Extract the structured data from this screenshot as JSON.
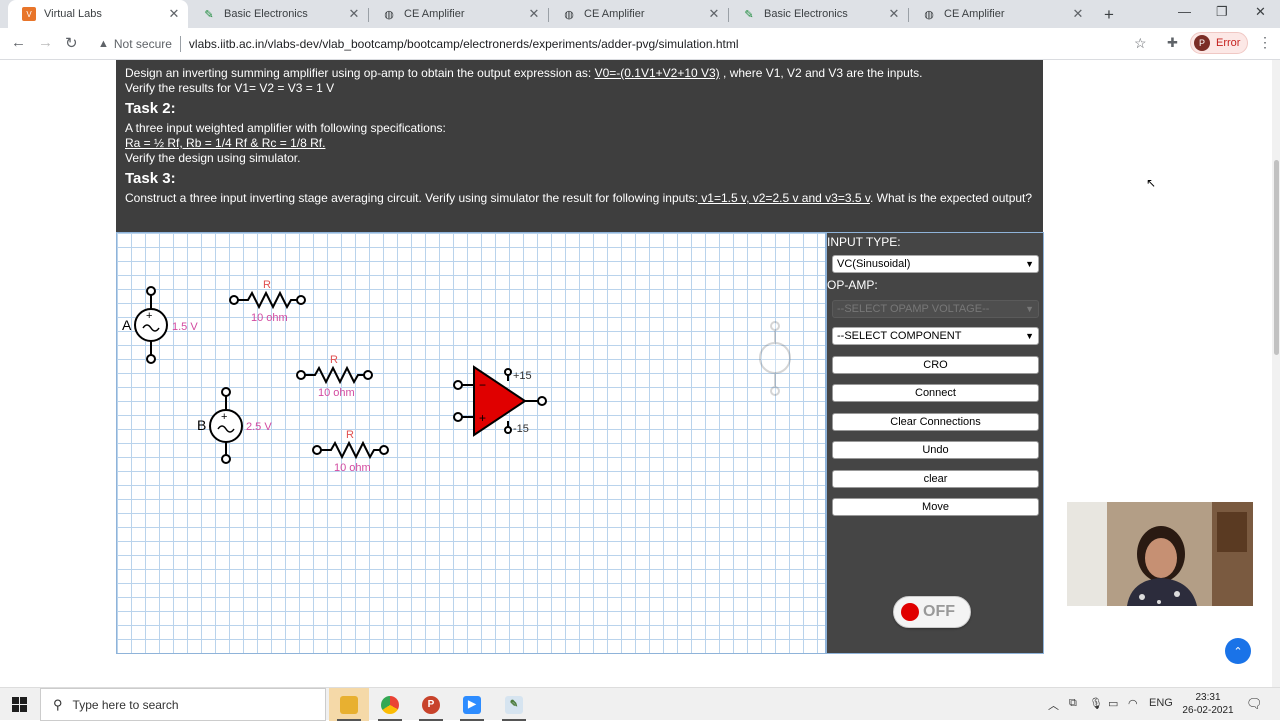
{
  "browser": {
    "tabs": [
      {
        "label": "Virtual Labs",
        "icon": "virtual-labs-icon",
        "active": true
      },
      {
        "label": "Basic Electronics",
        "icon": "pen-icon",
        "active": false
      },
      {
        "label": "CE Amplifier",
        "icon": "globe-icon",
        "active": false
      },
      {
        "label": "CE Amplifier",
        "icon": "globe-icon",
        "active": false
      },
      {
        "label": "Basic Electronics",
        "icon": "pen-icon",
        "active": false
      },
      {
        "label": "CE Amplifier",
        "icon": "globe-icon",
        "active": false
      }
    ],
    "security_label": "Not secure",
    "url": "vlabs.iitb.ac.in/vlabs-dev/vlab_bootcamp/bootcamp/electronerds/experiments/adder-pvg/simulation.html",
    "profile_initial": "P",
    "profile_status": "Error"
  },
  "tasks": {
    "intro_line_1_prefix": "Design an inverting summing amplifier using op-amp to obtain the output expression as: ",
    "intro_expression": "V0=-(0.1V1+V2+10 V3)",
    "intro_line_1_suffix": " , where V1, V2 and V3 are the inputs.",
    "intro_line_2": "Verify the results for V1= V2 = V3 = 1 V",
    "task2_heading": "Task 2:",
    "task2_line_1": "A three input weighted amplifier with following specifications:",
    "task2_spec": "Ra = ½ Rf, Rb = 1/4 Rf & Rc = 1/8 Rf.",
    "task2_line_3": "Verify the design using simulator.",
    "task3_heading": "Task 3:",
    "task3_prefix": "Construct a three input inverting stage averaging circuit. Verify using simulator the result for following inputs:",
    "task3_inputs": " v1=1.5 v, v2=2.5 v and v3=3.5 v",
    "task3_suffix": ". What is the expected output?"
  },
  "circuit": {
    "source_a": {
      "label": "A",
      "value": "1.5 V"
    },
    "source_b": {
      "label": "B",
      "value": "2.5 V"
    },
    "resistor_label": "R",
    "resistor_value": "10 ohm",
    "opamp_pos_supply": "+15",
    "opamp_neg_supply": "-15",
    "opamp_minus": "−",
    "opamp_plus": "+"
  },
  "panel": {
    "input_type_label": "INPUT TYPE:",
    "input_type_value": "VC(Sinusoidal)",
    "opamp_label": "OP-AMP:",
    "opamp_select_value": "--SELECT OPAMP VOLTAGE--",
    "component_select_value": "--SELECT COMPONENT",
    "buttons": [
      "CRO",
      "Connect",
      "Clear Connections",
      "Undo",
      "clear",
      "Move"
    ],
    "power_label": "OFF"
  },
  "taskbar": {
    "search_placeholder": "Type here to search",
    "language": "ENG",
    "time": "23:31",
    "date": "26-02-2021"
  },
  "colors": {
    "opamp_fill": "#e00000",
    "component_label": "#d24aa0",
    "resistor_r_label": "#e05050"
  }
}
